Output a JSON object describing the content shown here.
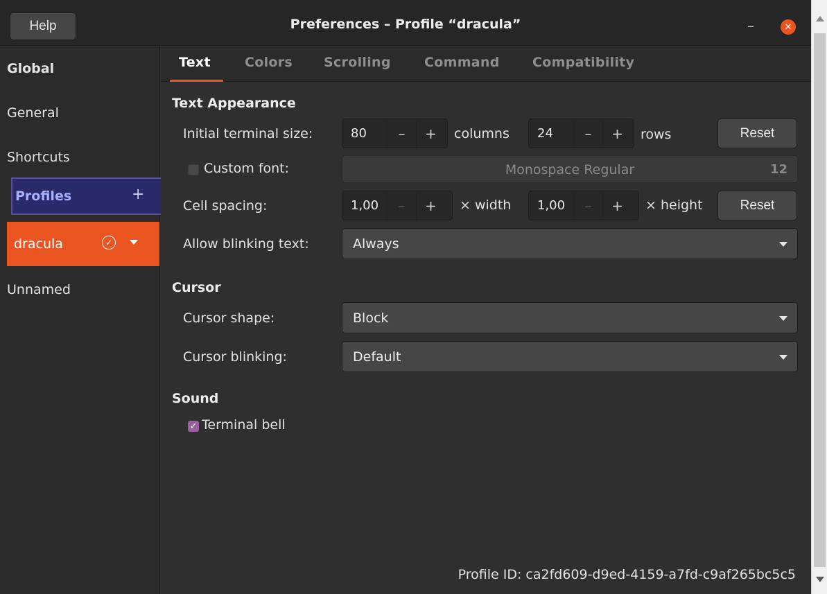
{
  "window": {
    "title": "Preferences – Profile “dracula”",
    "help_label": "Help",
    "minimize_glyph": "–",
    "close_glyph": "✕"
  },
  "sidebar": {
    "global": "Global",
    "general": "General",
    "shortcuts": "Shortcuts",
    "profiles": "Profiles",
    "profiles_add": "+",
    "active_profile": "dracula",
    "default_check": "✓",
    "other_profile": "Unnamed"
  },
  "tabs": {
    "text": "Text",
    "colors": "Colors",
    "scrolling": "Scrolling",
    "command": "Command",
    "compatibility": "Compatibility"
  },
  "text_appearance": {
    "heading": "Text Appearance",
    "initial_size_label": "Initial terminal size:",
    "columns_value": "80",
    "columns_unit": "columns",
    "rows_value": "24",
    "rows_unit": "rows",
    "reset_label": "Reset",
    "custom_font_label": "Custom font:",
    "font_name": "Monospace Regular",
    "font_size": "12",
    "cell_spacing_label": "Cell spacing:",
    "width_value": "1,00",
    "width_unit": "× width",
    "height_value": "1,00",
    "height_unit": "× height",
    "reset_label_2": "Reset",
    "blinking_label": "Allow blinking text:",
    "blinking_value": "Always",
    "minus": "–",
    "plus": "+"
  },
  "cursor": {
    "heading": "Cursor",
    "shape_label": "Cursor shape:",
    "shape_value": "Block",
    "blinking_label": "Cursor blinking:",
    "blinking_value": "Default"
  },
  "sound": {
    "heading": "Sound",
    "bell_label": "Terminal bell",
    "bell_check": "✓"
  },
  "profile_id": "Profile ID: ca2fd609-d9ed-4159-a7fd-c9af265bc5c5",
  "colors": {
    "accent": "#e95420",
    "selection": "#2a2a6b",
    "checkbox_on": "#9a5fa0"
  }
}
